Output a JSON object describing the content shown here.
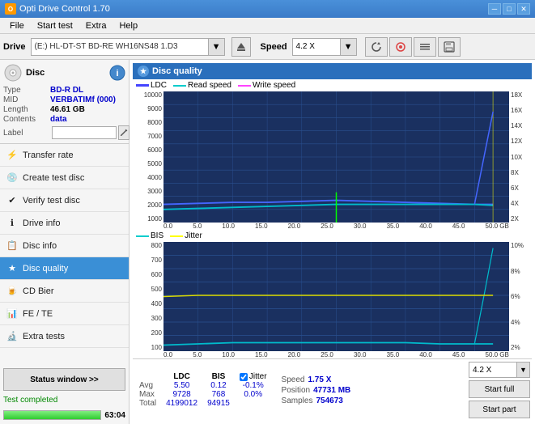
{
  "titleBar": {
    "title": "Opti Drive Control 1.70",
    "minimizeLabel": "─",
    "maximizeLabel": "□",
    "closeLabel": "✕"
  },
  "menuBar": {
    "items": [
      "File",
      "Start test",
      "Extra",
      "Help"
    ]
  },
  "driveBar": {
    "driveLabel": "Drive",
    "driveValue": "(E:)  HL-DT-ST BD-RE  WH16NS48 1.D3",
    "speedLabel": "Speed",
    "speedValue": "4.2 X"
  },
  "disc": {
    "title": "Disc",
    "typeLabel": "Type",
    "typeValue": "BD-R DL",
    "midLabel": "MID",
    "midValue": "VERBATIMf (000)",
    "lengthLabel": "Length",
    "lengthValue": "46.61 GB",
    "contentsLabel": "Contents",
    "contentsValue": "data",
    "labelLabel": "Label",
    "labelValue": ""
  },
  "nav": {
    "items": [
      {
        "id": "transfer-rate",
        "label": "Transfer rate",
        "icon": "⚡"
      },
      {
        "id": "create-test-disc",
        "label": "Create test disc",
        "icon": "💿"
      },
      {
        "id": "verify-test-disc",
        "label": "Verify test disc",
        "icon": "✔"
      },
      {
        "id": "drive-info",
        "label": "Drive info",
        "icon": "ℹ"
      },
      {
        "id": "disc-info",
        "label": "Disc info",
        "icon": "📋"
      },
      {
        "id": "disc-quality",
        "label": "Disc quality",
        "icon": "★",
        "active": true
      },
      {
        "id": "cd-bier",
        "label": "CD Bier",
        "icon": "🍺"
      },
      {
        "id": "fe-te",
        "label": "FE / TE",
        "icon": "📊"
      },
      {
        "id": "extra-tests",
        "label": "Extra tests",
        "icon": "🔬"
      }
    ],
    "statusBtn": "Status window >>"
  },
  "statusBar": {
    "text": "Test completed",
    "progress": 100,
    "score": "63:04"
  },
  "chart": {
    "title": "Disc quality",
    "legend": {
      "ldc": "LDC",
      "readSpeed": "Read speed",
      "writeSpeed": "Write speed"
    },
    "legend2": {
      "bis": "BIS",
      "jitter": "Jitter"
    },
    "upperYMax": 10000,
    "upperYLabels": [
      "10000",
      "9000",
      "8000",
      "7000",
      "6000",
      "5000",
      "4000",
      "3000",
      "2000",
      "1000"
    ],
    "upperYRight": [
      "18X",
      "16X",
      "14X",
      "12X",
      "10X",
      "8X",
      "6X",
      "4X",
      "2X"
    ],
    "lowerYLabels": [
      "800",
      "700",
      "600",
      "500",
      "400",
      "300",
      "200",
      "100"
    ],
    "lowerYRight": [
      "10%",
      "8%",
      "6%",
      "4%",
      "2%"
    ],
    "xLabels": [
      "0.0",
      "5.0",
      "10.0",
      "15.0",
      "20.0",
      "25.0",
      "30.0",
      "35.0",
      "40.0",
      "45.0",
      "50.0 GB"
    ]
  },
  "stats": {
    "ldcLabel": "LDC",
    "bisLabel": "BIS",
    "jitterLabel": "Jitter",
    "avgLabel": "Avg",
    "maxLabel": "Max",
    "totalLabel": "Total",
    "ldcAvg": "5.50",
    "ldcMax": "9728",
    "ldcTotal": "4199012",
    "bisAvg": "0.12",
    "bisMax": "768",
    "bisTotal": "94915",
    "jitterAvg": "-0.1%",
    "jitterMax": "0.0%",
    "jitterChecked": true,
    "speedLabel": "Speed",
    "speedValue": "1.75 X",
    "positionLabel": "Position",
    "positionValue": "47731 MB",
    "samplesLabel": "Samples",
    "samplesValue": "754673",
    "speedSelectValue": "4.2 X",
    "startFullLabel": "Start full",
    "startPartLabel": "Start part"
  }
}
